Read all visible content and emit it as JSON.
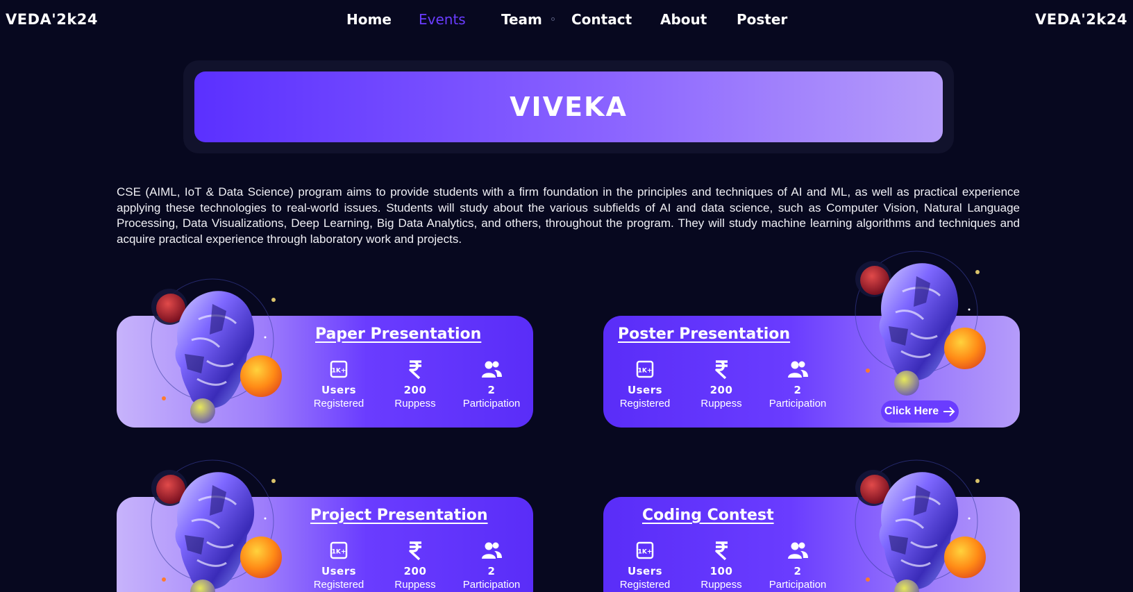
{
  "nav": {
    "brand_left": "VEDA'2k24",
    "brand_right": "VEDA'2k24",
    "links": [
      {
        "label": "Home",
        "active": false
      },
      {
        "label": "Events",
        "active": true
      },
      {
        "label": "Team",
        "active": false
      },
      {
        "label": "Contact",
        "active": false
      },
      {
        "label": "About",
        "active": false
      },
      {
        "label": "Poster",
        "active": false
      }
    ]
  },
  "hero": {
    "title": "VIVEKA"
  },
  "description": "CSE (AIML, IoT & Data Science) program aims to provide students with a firm foundation in the principles and techniques of AI and ML, as well as practical experience applying these technologies to real-world issues. Students will study about the various subfields of AI and data science, such as Computer Vision, Natural Language Processing, Data Visualizations, Deep Learning, Big Data Analytics, and others, throughout the program. They will study machine learning algorithms and techniques and acquire practical experience through laboratory work and projects.",
  "events": [
    {
      "title": "Paper Presentation",
      "stats": [
        {
          "icon": "users-count-icon",
          "icon_text": "1K+",
          "value": "Users",
          "label": "Registered"
        },
        {
          "icon": "rupee-icon",
          "value": "200",
          "label": "Ruppess"
        },
        {
          "icon": "people-icon",
          "value": "2",
          "label": "Participation"
        }
      ]
    },
    {
      "title": "Poster Presentation",
      "stats": [
        {
          "icon": "users-count-icon",
          "icon_text": "1K+",
          "value": "Users",
          "label": "Registered"
        },
        {
          "icon": "rupee-icon",
          "value": "200",
          "label": "Ruppess"
        },
        {
          "icon": "people-icon",
          "value": "2",
          "label": "Participation"
        }
      ],
      "button": "Click Here"
    },
    {
      "title": "Project Presentation",
      "stats": [
        {
          "icon": "users-count-icon",
          "icon_text": "1K+",
          "value": "Users",
          "label": "Registered"
        },
        {
          "icon": "rupee-icon",
          "value": "200",
          "label": "Ruppess"
        },
        {
          "icon": "people-icon",
          "value": "2",
          "label": "Participation"
        }
      ]
    },
    {
      "title": "Coding Contest",
      "stats": [
        {
          "icon": "users-count-icon",
          "icon_text": "1K+",
          "value": "Users",
          "label": "Registered"
        },
        {
          "icon": "rupee-icon",
          "value": "100",
          "label": "Ruppess"
        },
        {
          "icon": "people-icon",
          "value": "2",
          "label": "Participation"
        }
      ]
    }
  ],
  "colors": {
    "background": "#07081f",
    "accent": "#6a3cff",
    "hero_gradient_start": "#5b30ff",
    "hero_gradient_end": "#b69dfa"
  }
}
